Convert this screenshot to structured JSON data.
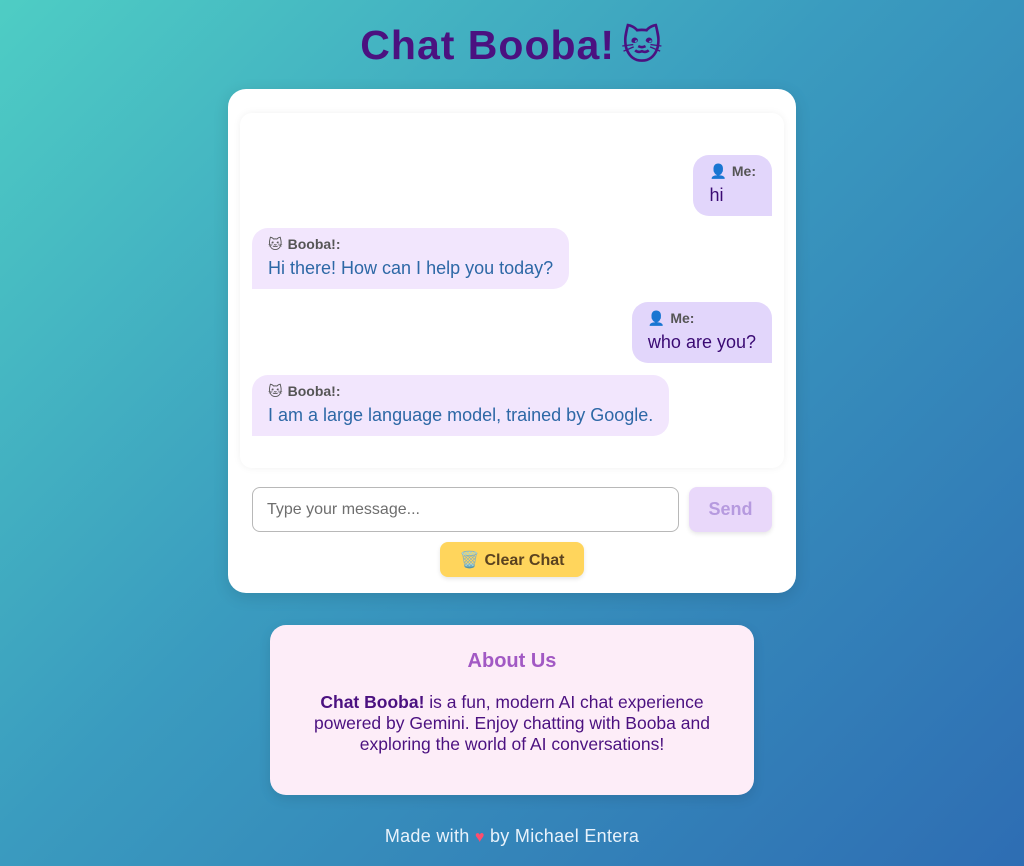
{
  "header": {
    "title": "Chat Booba!",
    "title_emoji": "🐱"
  },
  "chat": {
    "messages": [
      {
        "sender": "me",
        "icon": "👤",
        "label": "Me:",
        "text": "hi"
      },
      {
        "sender": "bot",
        "icon": "🐱",
        "label": "Booba!:",
        "text": "Hi there! How can I help you today?"
      },
      {
        "sender": "me",
        "icon": "👤",
        "label": "Me:",
        "text": "who are you?"
      },
      {
        "sender": "bot",
        "icon": "🐱",
        "label": "Booba!:",
        "text": "I am a large language model, trained by Google."
      }
    ],
    "input_placeholder": "Type your message...",
    "input_value": "",
    "send_label": "Send",
    "clear_icon": "🗑️",
    "clear_label": "Clear Chat"
  },
  "about": {
    "heading": "About Us",
    "brand": "Chat Booba!",
    "description": "is a fun, modern AI chat experience powered by Gemini. Enjoy chatting with Booba and exploring the world of AI conversations!"
  },
  "footer": {
    "prefix": "Made with",
    "heart": "♥",
    "suffix": "by Michael Entera"
  },
  "colors": {
    "title": "#4b1180",
    "me_bubble": "#e2d6fb",
    "bot_bubble": "#f2e6fd",
    "send_button": "#e9d8fa",
    "clear_button": "#ffd55c",
    "about_bg": "#fdedf8",
    "about_heading": "#a259c4",
    "heart": "#ff4d6d"
  }
}
